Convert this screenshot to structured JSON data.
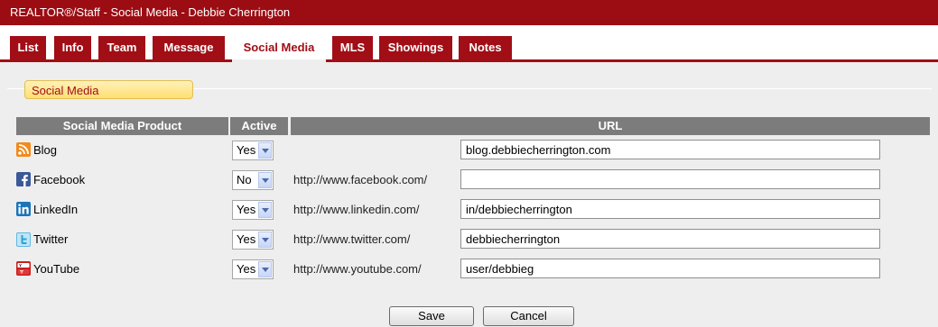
{
  "window": {
    "title": "REALTOR®/Staff - Social Media - Debbie Cherrington"
  },
  "tabs": [
    "List",
    "Info",
    "Team",
    "Message",
    "Social Media",
    "MLS",
    "Showings",
    "Notes"
  ],
  "active_tab": "Social Media",
  "section": {
    "legend": "Social Media"
  },
  "table": {
    "headers": {
      "product": "Social Media Product",
      "active": "Active",
      "url": "URL"
    },
    "rows": [
      {
        "product": "Blog",
        "icon": "rss-icon",
        "active": "Yes",
        "prefix": "",
        "url": "blog.debbiecherrington.com"
      },
      {
        "product": "Facebook",
        "icon": "facebook-icon",
        "active": "No",
        "prefix": "http://www.facebook.com/",
        "url": ""
      },
      {
        "product": "LinkedIn",
        "icon": "linkedin-icon",
        "active": "Yes",
        "prefix": "http://www.linkedin.com/",
        "url": "in/debbiecherrington"
      },
      {
        "product": "Twitter",
        "icon": "twitter-icon",
        "active": "Yes",
        "prefix": "http://www.twitter.com/",
        "url": "debbiecherrington"
      },
      {
        "product": "YouTube",
        "icon": "youtube-icon",
        "active": "Yes",
        "prefix": "http://www.youtube.com/",
        "url": "user/debbieg"
      }
    ]
  },
  "buttons": {
    "save": "Save",
    "cancel": "Cancel"
  },
  "colors": {
    "brand": "#9b0d13",
    "legend_bg": "#ffdf73",
    "header_bg": "#7c7c7c"
  }
}
